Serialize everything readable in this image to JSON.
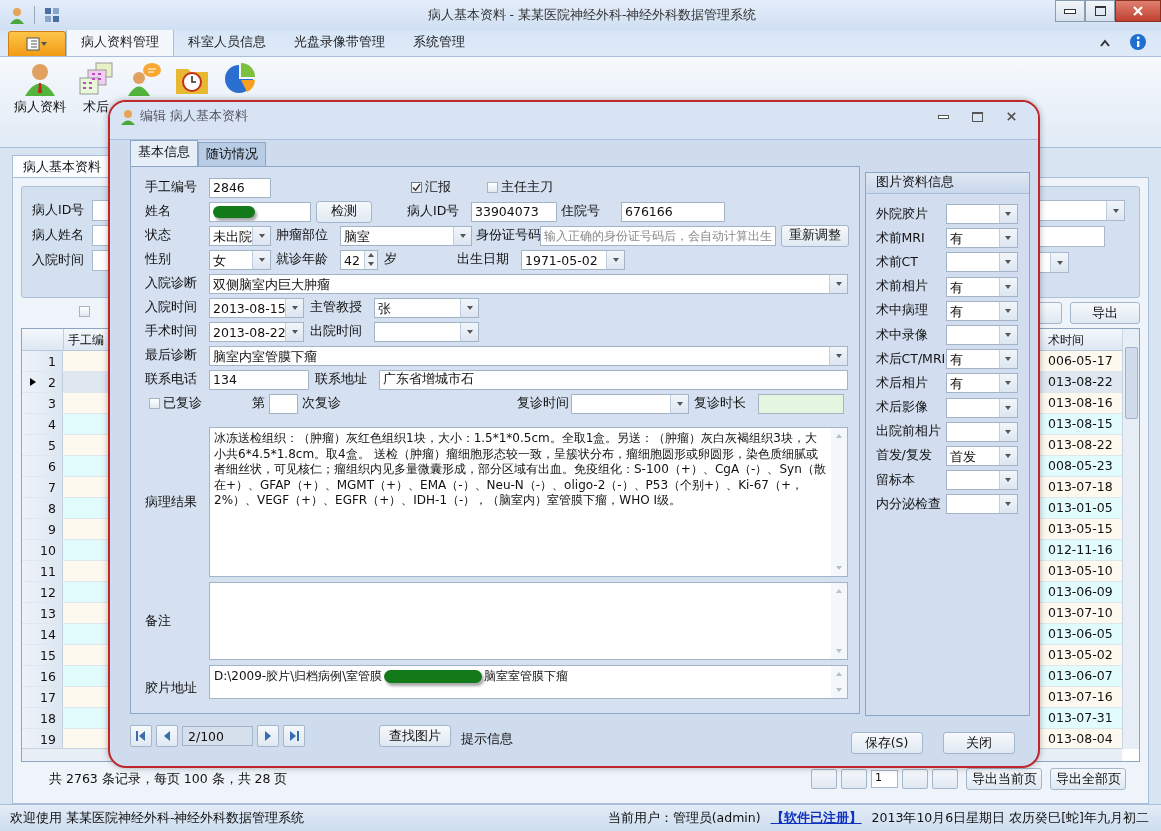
{
  "window": {
    "title": "病人基本资料 - 某某医院神经外科-神经外科数据管理系统"
  },
  "ribbon": {
    "tabs": [
      {
        "label": "病人资料管理",
        "selected": true
      },
      {
        "label": "科室人员信息",
        "selected": false
      },
      {
        "label": "光盘录像带管理",
        "selected": false
      },
      {
        "label": "系统管理",
        "selected": false
      }
    ],
    "buttons": [
      {
        "label": "病人资料",
        "kind": "person"
      },
      {
        "label": "术后",
        "kind": "calendar"
      },
      {
        "kind": "chat"
      },
      {
        "kind": "folder"
      },
      {
        "kind": "pie"
      }
    ]
  },
  "doc_tab": {
    "label": "病人基本资料"
  },
  "filter": {
    "fields": [
      {
        "label": "病人ID号"
      },
      {
        "label": "病人姓名"
      },
      {
        "label": "入院时间"
      }
    ],
    "checkbox": {
      "checked": false
    },
    "export_button": "导出"
  },
  "grid": {
    "columns": [
      "手工编",
      "术时间"
    ],
    "rows": [
      {
        "number": "1",
        "date": "006-05-17",
        "selected": false
      },
      {
        "number": "2",
        "date": "013-08-22",
        "selected": true
      },
      {
        "number": "3",
        "date": "013-08-16",
        "selected": false
      },
      {
        "number": "4",
        "date": "013-08-15",
        "selected": false
      },
      {
        "number": "5",
        "date": "013-08-22",
        "selected": false
      },
      {
        "number": "6",
        "date": "008-05-23",
        "selected": false
      },
      {
        "number": "7",
        "date": "013-07-18",
        "selected": false
      },
      {
        "number": "8",
        "date": "013-01-05",
        "selected": false
      },
      {
        "number": "9",
        "date": "013-05-15",
        "selected": false
      },
      {
        "number": "10",
        "date": "012-11-16",
        "selected": false
      },
      {
        "number": "11",
        "date": "013-05-10",
        "selected": false
      },
      {
        "number": "12",
        "date": "013-06-09",
        "selected": false
      },
      {
        "number": "13",
        "date": "013-07-10",
        "selected": false
      },
      {
        "number": "14",
        "date": "013-06-05",
        "selected": false
      },
      {
        "number": "15",
        "date": "013-05-02",
        "selected": false
      },
      {
        "number": "16",
        "date": "013-06-07",
        "selected": false
      },
      {
        "number": "17",
        "date": "013-07-16",
        "selected": false
      },
      {
        "number": "18",
        "date": "013-07-31",
        "selected": false
      },
      {
        "number": "19",
        "date": "013-08-04",
        "selected": false
      }
    ]
  },
  "pager": {
    "summary": "共 2763 条记录，每页 100 条，共 28 页",
    "page": "1",
    "buttons": [
      "导出当前页",
      "导出全部页"
    ]
  },
  "status_bar": {
    "welcome": "欢迎使用 某某医院神经外科-神经外科数据管理系统",
    "user": "当前用户：管理员(admin)",
    "registered": "【软件已注册】",
    "date": "2013年10月6日星期日 农历癸巳[蛇]年九月初二"
  },
  "dialog": {
    "title": "编辑 病人基本资料",
    "tabs": [
      {
        "label": "基本信息",
        "selected": true
      },
      {
        "label": "随访情况",
        "selected": false
      }
    ],
    "manual_no": {
      "label": "手工编号",
      "value": "2846"
    },
    "report": {
      "label": "汇报",
      "checked": true
    },
    "chief_surgeon": {
      "label": "主任主刀",
      "checked": false
    },
    "name": {
      "label": "姓名"
    },
    "check_button": "检测",
    "patient_id": {
      "label": "病人ID号",
      "value": "33904073"
    },
    "inpatient_no": {
      "label": "住院号",
      "value": "676166"
    },
    "status": {
      "label": "状态",
      "value": "未出院"
    },
    "tumor_site": {
      "label": "肿瘤部位",
      "value": "脑室"
    },
    "id_card": {
      "label": "身份证号码",
      "placeholder": "输入正确的身份证号码后，会自动计算出生"
    },
    "readjust_button": "重新调整",
    "sex": {
      "label": "性别",
      "value": "女"
    },
    "age": {
      "label": "就诊年龄",
      "value": "42",
      "unit": "岁"
    },
    "birth_date": {
      "label": "出生日期",
      "value": "1971-05-02"
    },
    "admission_diagnosis": {
      "label": "入院诊断",
      "value": "双侧脑室内巨大肿瘤"
    },
    "admission_date": {
      "label": "入院时间",
      "value": "2013-08-15"
    },
    "professor": {
      "label": "主管教授",
      "value": "张"
    },
    "surgery_date": {
      "label": "手术时间",
      "value": "2013-08-22"
    },
    "discharge_date": {
      "label": "出院时间"
    },
    "final_diagnosis": {
      "label": "最后诊断",
      "value": "脑室内室管膜下瘤"
    },
    "phone": {
      "label": "联系电话",
      "value": "134"
    },
    "address": {
      "label": "联系地址",
      "value": "广东省增城市石"
    },
    "revisited": {
      "label": "已复诊",
      "checked": false
    },
    "revisit_count": {
      "prefix": "第",
      "suffix": "次复诊"
    },
    "revisit_time": {
      "label": "复诊时间"
    },
    "revisit_duration": {
      "label": "复诊时长"
    },
    "pathology": {
      "label": "病理结果",
      "value": "冰冻送检组织：（肿瘤）灰红色组织1块，大小：1.5*1*0.5cm。全取1盒。另送：（肿瘤）灰白灰褐组织3块，大小共6*4.5*1.8cm。取4盒。 送检（肿瘤）瘤细胞形态较一致，呈簇状分布，瘤细胞圆形或卵圆形，染色质细腻或者细丝状，可见核仁；瘤组织内见多量微囊形成，部分区域有出血。免疫组化：S-100（+）、CgA（-）、Syn（散在+）、GFAP（+）、MGMT（+）、EMA（-）、Neu-N（-）、oligo-2（-）、P53（个别+）、Ki-67（+，2%）、VEGF（+）、EGFR（+）、IDH-1（-），（脑室内）室管膜下瘤，WHO Ⅰ级。"
    },
    "notes": {
      "label": "备注"
    },
    "film_path": {
      "label": "胶片地址",
      "value_start": "D:\\2009-胶片\\归档病例\\室管膜",
      "value_end": "脑室室管膜下瘤"
    },
    "image_info": {
      "title": "图片资料信息",
      "items": [
        {
          "label": "外院胶片"
        },
        {
          "label": "术前MRI",
          "value": "有"
        },
        {
          "label": "术前CT"
        },
        {
          "label": "术前相片",
          "value": "有"
        },
        {
          "label": "术中病理",
          "value": "有"
        },
        {
          "label": "术中录像"
        },
        {
          "label": "术后CT/MRI",
          "value": "有"
        },
        {
          "label": "术后相片",
          "value": "有"
        },
        {
          "label": "术后影像"
        },
        {
          "label": "出院前相片"
        },
        {
          "label": "首发/复发",
          "value": "首发"
        },
        {
          "label": "留标本"
        },
        {
          "label": "内分泌检查"
        }
      ]
    },
    "navigator": {
      "page": "2/100"
    },
    "find_button": "查找图片",
    "hint": "提示信息",
    "save_button": "保存(S)",
    "close_button": "关闭"
  }
}
